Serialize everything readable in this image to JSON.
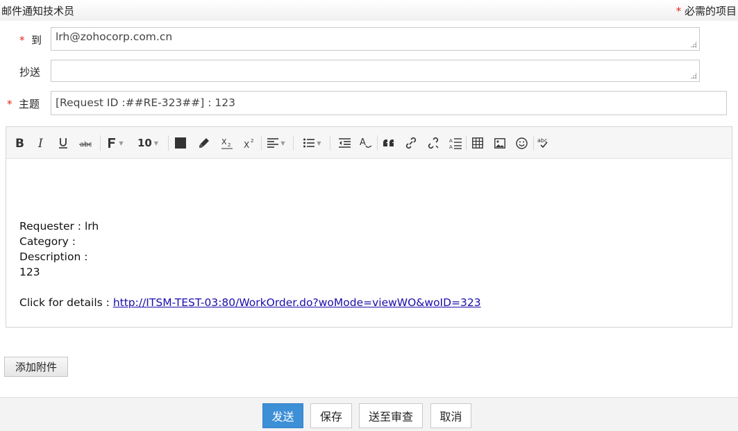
{
  "header": {
    "title": "邮件通知技术员",
    "required_star": "*",
    "required_label": "必需的项目"
  },
  "form": {
    "to": {
      "star": "*",
      "label": "到",
      "value": "lrh@zohocorp.com.cn"
    },
    "cc": {
      "label": "抄送",
      "value": ""
    },
    "subject": {
      "star": "*",
      "label": "主题",
      "value": "[Request ID :##RE-323##] : 123"
    }
  },
  "toolbar": {
    "font_size": "10",
    "tools": [
      "bold-icon",
      "italic-icon",
      "underline-icon",
      "strikethrough-icon",
      "font-family-icon",
      "font-size-selector",
      "font-color-icon",
      "highlight-icon",
      "subscript-icon",
      "superscript-icon",
      "align-icon",
      "list-icon",
      "outdent-icon",
      "clear-format-icon",
      "blockquote-icon",
      "link-icon",
      "unlink-icon",
      "line-height-icon",
      "table-icon",
      "image-icon",
      "emoji-icon",
      "spellcheck-icon"
    ]
  },
  "body": {
    "line1": "Requester : lrh",
    "line2": "Category :",
    "line3": "Description :",
    "line4": "123",
    "link_prefix": "Click for details : ",
    "link": "http://ITSM-TEST-03:80/WorkOrder.do?woMode=viewWO&woID=323"
  },
  "attach_label": "添加附件",
  "footer": {
    "send": "发送",
    "save": "保存",
    "review": "送至审查",
    "cancel": "取消"
  },
  "colors": {
    "primary": "#3d8fd6",
    "required": "#e0261a",
    "link": "#1a0dab"
  }
}
